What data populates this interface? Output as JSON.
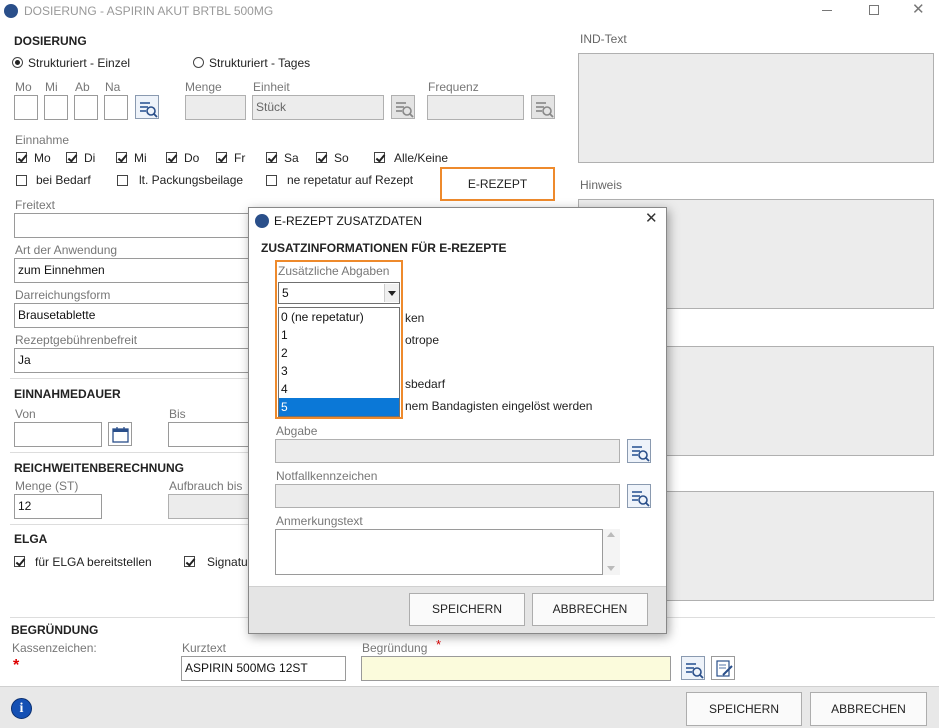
{
  "window": {
    "title": "DOSIERUNG - ASPIRIN AKUT BRTBL 500MG"
  },
  "dosierung": {
    "heading": "DOSIERUNG",
    "radio_einzel": "Strukturiert - Einzel",
    "radio_tages": "Strukturiert - Tages",
    "col_mo": "Mo",
    "col_mi": "Mi",
    "col_ab": "Ab",
    "col_na": "Na",
    "menge_label": "Menge",
    "einheit_label": "Einheit",
    "einheit_value": "Stück",
    "frequenz_label": "Frequenz",
    "einnahme_label": "Einnahme",
    "days": [
      "Mo",
      "Di",
      "Mi",
      "Do",
      "Fr",
      "Sa",
      "So"
    ],
    "alle_keine": "Alle/Keine",
    "bei_bedarf": "bei Bedarf",
    "packungsbeilage": "lt. Packungsbeilage",
    "ne_repetatur": "ne repetatur auf Rezept",
    "erezept_button": "E-REZEPT",
    "freitext_label": "Freitext",
    "art_label": "Art der Anwendung",
    "art_value": "zum Einnehmen",
    "darreichung_label": "Darreichungsform",
    "darreichung_value": "Brausetablette",
    "gebuehren_label": "Rezeptgebührenbefreit",
    "gebuehren_value": "Ja"
  },
  "einnahmedauer": {
    "heading": "EINNAHMEDAUER",
    "von_label": "Von",
    "bis_label": "Bis"
  },
  "reichweite": {
    "heading": "REICHWEITENBERECHNUNG",
    "menge_label": "Menge (ST)",
    "menge_value": "12",
    "aufbrauch_label": "Aufbrauch bis"
  },
  "elga": {
    "heading": "ELGA",
    "bereitstellen": "für ELGA bereitstellen",
    "signatur": "Signatur"
  },
  "begruendung": {
    "heading": "BEGRÜNDUNG",
    "kassenzeichen_label": "Kassenzeichen:",
    "star": "*",
    "kurztext_label": "Kurztext",
    "kurztext_value": "ASPIRIN 500MG 12ST",
    "begruendung_label": "Begründung"
  },
  "right_panel": {
    "ind_text_label": "IND-Text",
    "hinweis_label": "Hinweis"
  },
  "footer": {
    "speichern": "SPEICHERN",
    "abbrechen": "ABBRECHEN"
  },
  "dialog": {
    "title": "E-REZEPT ZUSATZDATEN",
    "heading": "ZUSATZINFORMATIONEN FÜR E-REZEPTE",
    "zusaetzliche_label": "Zusätzliche Abgaben",
    "selected_value": "5",
    "options": [
      "0 (ne repetatur)",
      "1",
      "2",
      "3",
      "4",
      "5"
    ],
    "behind_texts": [
      "ken",
      "otrope",
      "sbedarf",
      "nem Bandagisten eingelöst werden"
    ],
    "abgabe_label": "Abgabe",
    "notfall_label": "Notfallkennzeichen",
    "anmerkung_label": "Anmerkungstext",
    "speichern": "SPEICHERN",
    "abbrechen": "ABBRECHEN"
  },
  "colors": {
    "highlight_orange": "#ee8a2c",
    "selection_blue": "#0b78d7",
    "begruendung_yellow": "#fbfbdc"
  }
}
